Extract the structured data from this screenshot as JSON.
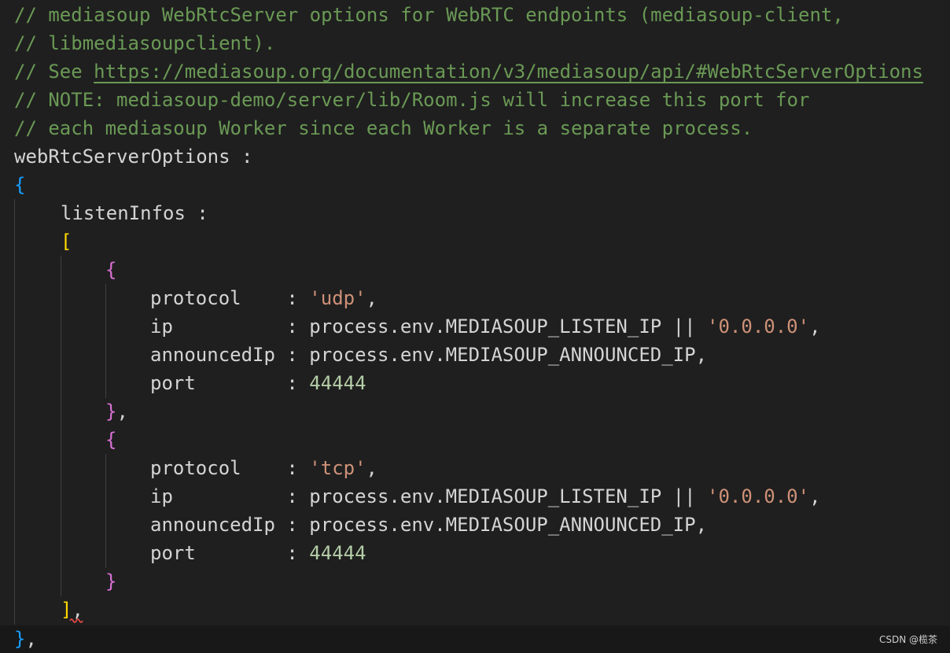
{
  "comments": {
    "line1": "// mediasoup WebRtcServer options for WebRTC endpoints (mediasoup-client,",
    "line2": "// libmediasoupclient).",
    "line3_prefix": "// See ",
    "line3_link": "https://mediasoup.org/documentation/v3/mediasoup/api/#WebRtcServerOptions",
    "line4": "// NOTE: mediasoup-demo/server/lib/Room.js will increase this port for",
    "line5": "// each mediasoup Worker since each Worker is a separate process."
  },
  "code": {
    "root_key": "webRtcServerOptions :",
    "open_brace": "{",
    "listen_key": "listenInfos :",
    "open_bracket": "[",
    "close_bracket": "]",
    "bracket_comma": ",",
    "close_brace_root": "}",
    "root_comma": ",",
    "entries": [
      {
        "open": "{",
        "protocol_key": "protocol    : ",
        "protocol_value": "'udp'",
        "protocol_comma": ",",
        "ip_key": "ip          : process.env.MEDIASOUP_LISTEN_IP || ",
        "ip_value": "'0.0.0.0'",
        "ip_comma": ",",
        "announced_line": "announcedIp : process.env.MEDIASOUP_ANNOUNCED_IP,",
        "port_key": "port        : ",
        "port_value": "44444",
        "close": "}",
        "close_comma": ","
      },
      {
        "open": "{",
        "protocol_key": "protocol    : ",
        "protocol_value": "'tcp'",
        "protocol_comma": ",",
        "ip_key": "ip          : process.env.MEDIASOUP_LISTEN_IP || ",
        "ip_value": "'0.0.0.0'",
        "ip_comma": ",",
        "announced_line": "announcedIp : process.env.MEDIASOUP_ANNOUNCED_IP,",
        "port_key": "port        : ",
        "port_value": "44444",
        "close": "}",
        "close_comma": ""
      }
    ]
  },
  "watermark": "CSDN @榄茶",
  "colors": {
    "background": "#1f1f1f",
    "comment": "#6a9955",
    "string": "#ce9178",
    "number": "#b5cea8",
    "bracket_level1": "#179fff",
    "bracket_level2": "#ffd700",
    "bracket_level3": "#da70d6",
    "error_squiggle": "#f14c4c"
  }
}
